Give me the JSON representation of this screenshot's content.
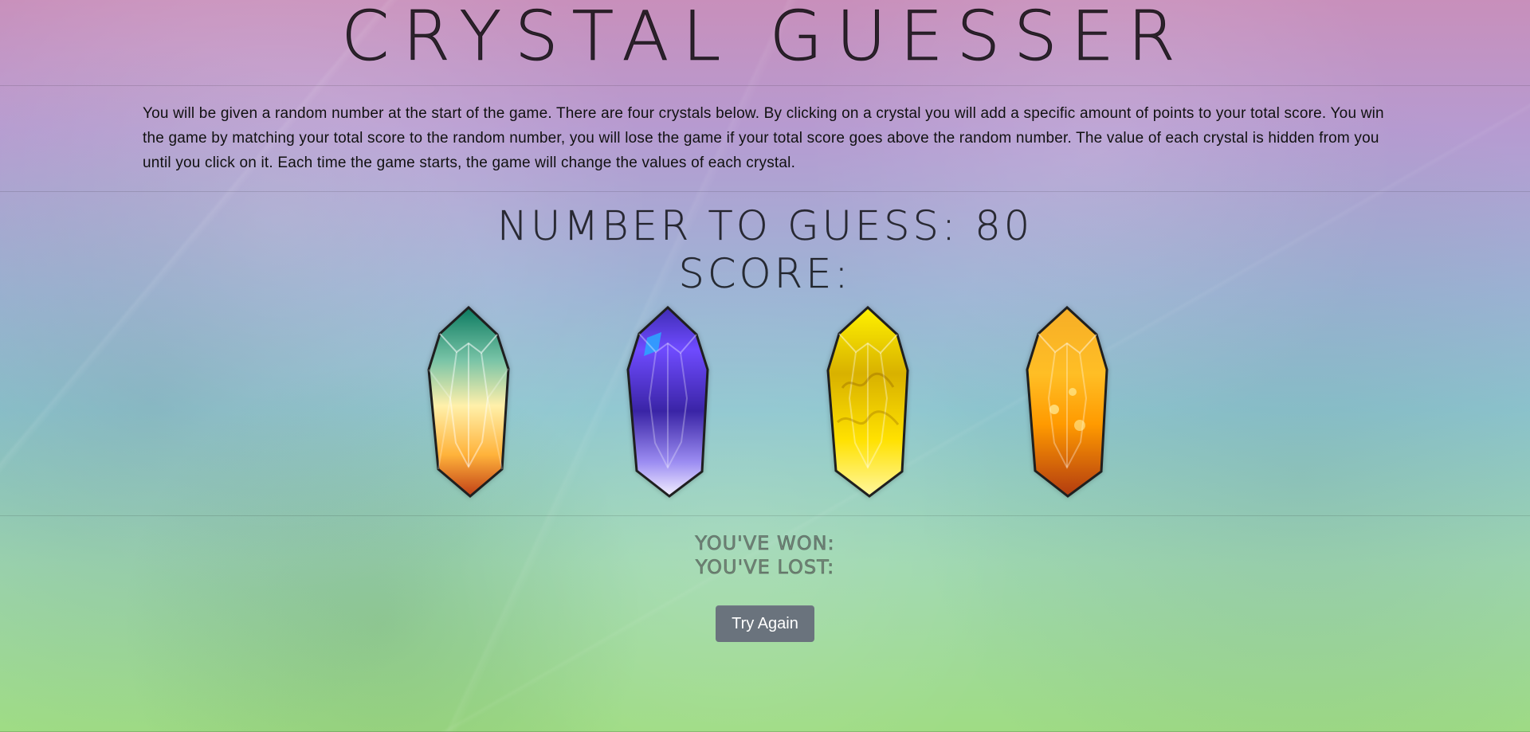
{
  "page": {
    "title": "CRYSTAL GUESSER",
    "instructions": "You will be given a random number at the start of the game. There are four crystals below. By clicking on a crystal you will add a specific amount of points to your total score. You win the game by matching your total score to the random number, you will lose the game if your total score goes above the random number. The value of each crystal is hidden from you until you click on it. Each time the game starts, the game will change the values of each crystal.",
    "number_to_guess_label": "NUMBER TO GUESS: 80",
    "score_label": "SCORE:",
    "won_label": "YOU'VE WON:",
    "lost_label": "YOU'VE LOST:",
    "try_again_label": "Try Again"
  },
  "crystals": [
    {
      "name": "green-orange-crystal"
    },
    {
      "name": "purple-crystal"
    },
    {
      "name": "yellow-crystal"
    },
    {
      "name": "orange-crystal"
    }
  ],
  "colors": {
    "button": "#6a737d",
    "title": "#1f1f1f"
  }
}
